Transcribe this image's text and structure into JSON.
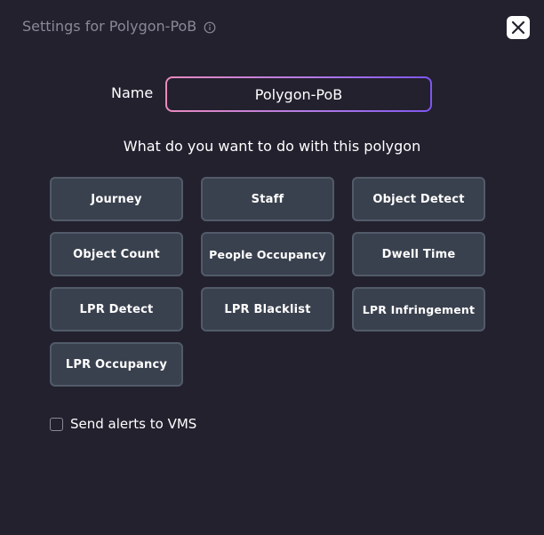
{
  "dialog": {
    "title": "Settings for Polygon-PoB",
    "info_icon": "info-icon",
    "close_icon": "close-icon"
  },
  "name_field": {
    "label": "Name",
    "value": "Polygon-PoB"
  },
  "question": "What do you want to do with this polygon",
  "options": [
    {
      "label": "Journey"
    },
    {
      "label": "Staff"
    },
    {
      "label": "Object Detect"
    },
    {
      "label": "Object Count"
    },
    {
      "label": "People Occupancy"
    },
    {
      "label": "Dwell Time"
    },
    {
      "label": "LPR Detect"
    },
    {
      "label": "LPR Blacklist"
    },
    {
      "label": "LPR Infringement"
    },
    {
      "label": "LPR Occupancy"
    }
  ],
  "alerts": {
    "label": "Send alerts to VMS",
    "checked": false
  },
  "colors": {
    "background": "#23212e",
    "button_bg": "#3a414e",
    "button_border": "#525b69",
    "gradient_start": "#e98abf",
    "gradient_end": "#7e56f0"
  }
}
